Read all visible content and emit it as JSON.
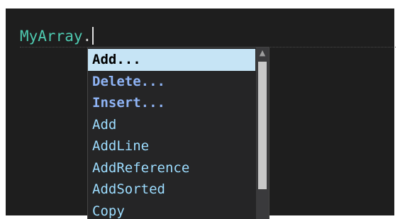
{
  "editor": {
    "code_identifier": "MyArray",
    "code_dot": "."
  },
  "completion": {
    "items": [
      {
        "label": "Add...",
        "kind": "snippet",
        "selected": true
      },
      {
        "label": "Delete...",
        "kind": "snippet",
        "selected": false
      },
      {
        "label": "Insert...",
        "kind": "snippet",
        "selected": false
      },
      {
        "label": "Add",
        "kind": "method",
        "selected": false
      },
      {
        "label": "AddLine",
        "kind": "method",
        "selected": false
      },
      {
        "label": "AddReference",
        "kind": "method",
        "selected": false
      },
      {
        "label": "AddSorted",
        "kind": "method",
        "selected": false
      },
      {
        "label": "Copy",
        "kind": "method",
        "selected": false
      }
    ],
    "scroll_up_icon": "▲"
  },
  "colors": {
    "editor_background": "#1e1e1e",
    "identifier": "#4ec9b0",
    "member_text": "#9cdcfe",
    "selected_background": "#c6e4f5"
  }
}
